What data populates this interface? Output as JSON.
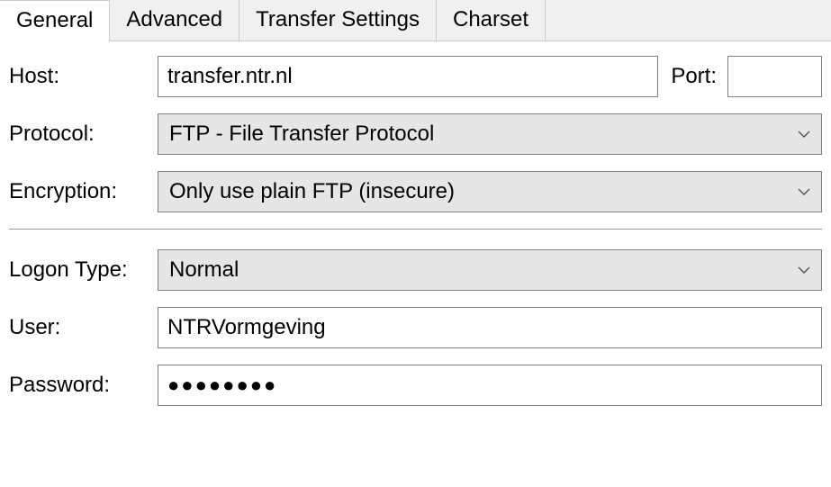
{
  "tabs": {
    "general": "General",
    "advanced": "Advanced",
    "transfer": "Transfer Settings",
    "charset": "Charset"
  },
  "labels": {
    "host": "Host:",
    "port": "Port:",
    "protocol": "Protocol:",
    "encryption": "Encryption:",
    "logon_type": "Logon Type:",
    "user": "User:",
    "password": "Password:"
  },
  "values": {
    "host": "transfer.ntr.nl",
    "port": "",
    "protocol": "FTP - File Transfer Protocol",
    "encryption": "Only use plain FTP (insecure)",
    "logon_type": "Normal",
    "user": "NTRVormgeving",
    "password": "●●●●●●●●"
  }
}
